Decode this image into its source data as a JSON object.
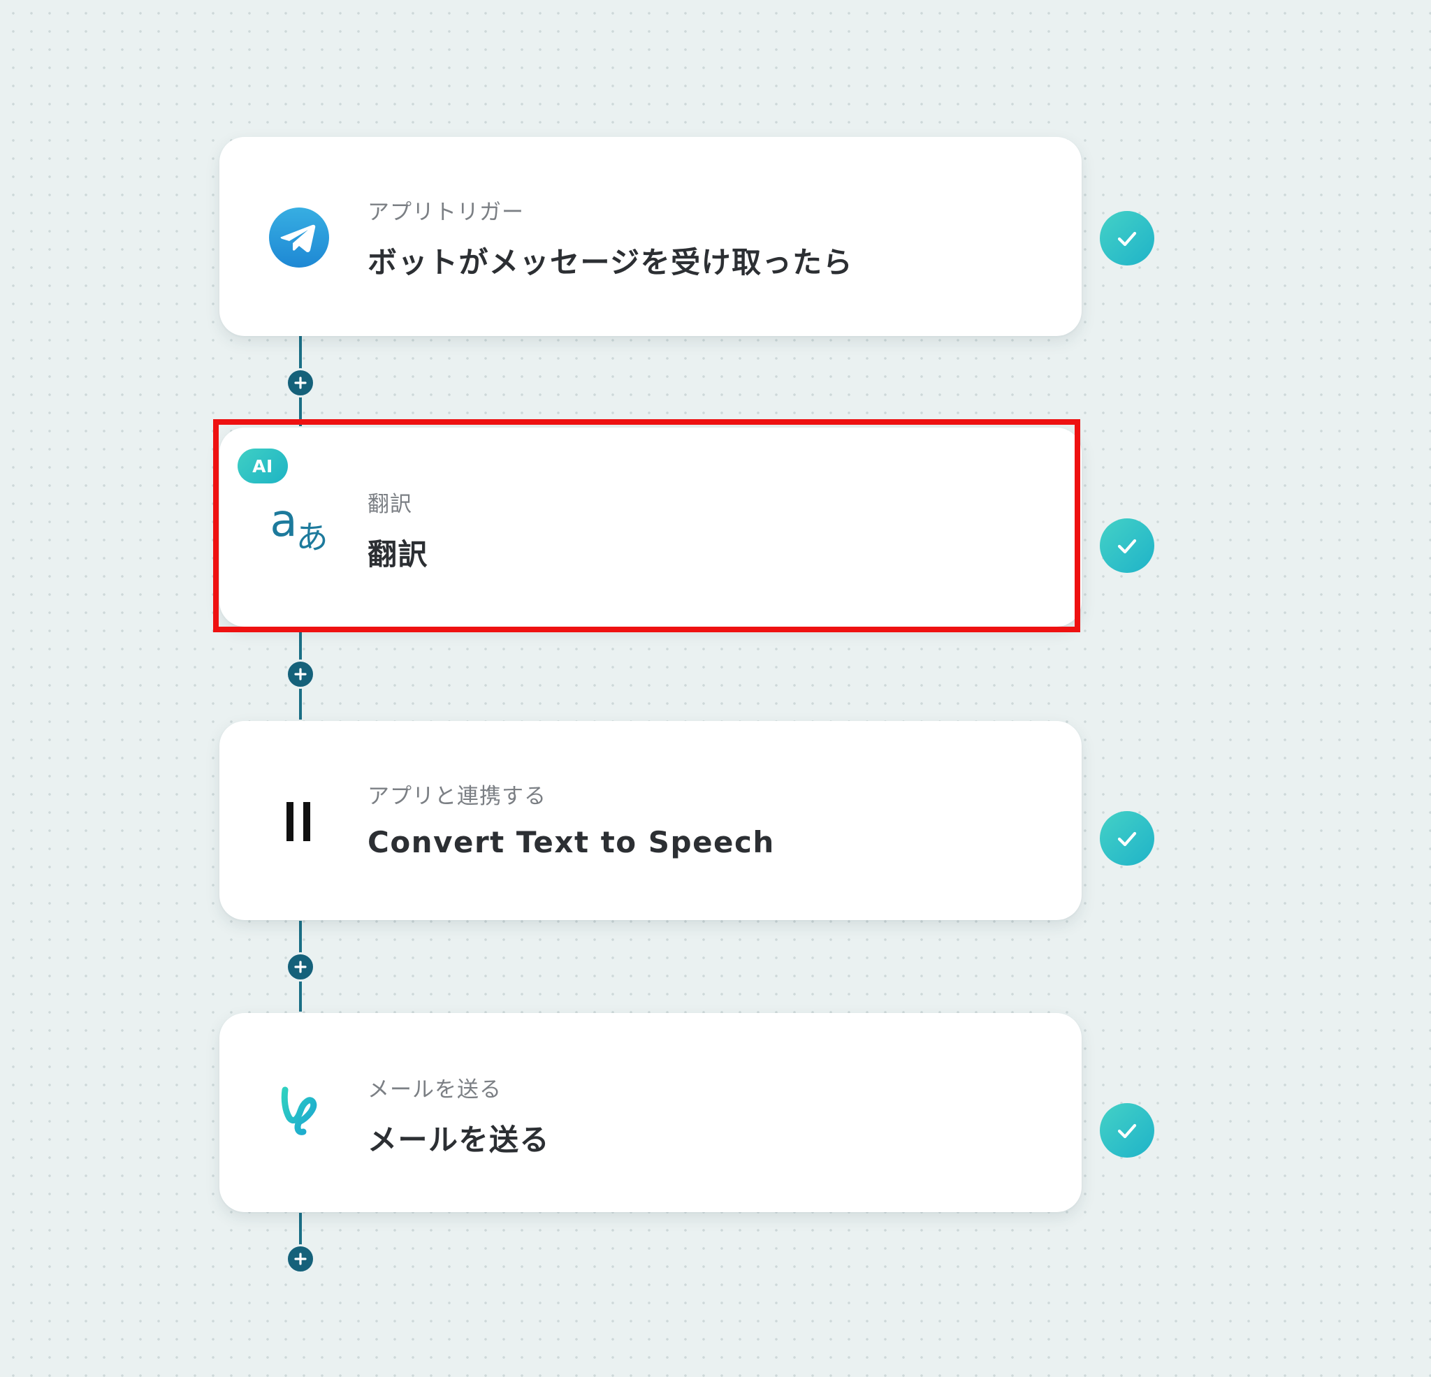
{
  "colors": {
    "background": "#eaf1f1",
    "connector": "#15617a",
    "check": "#1fb3c9",
    "selection": "#ee1111",
    "telegram": "#2b9fdc"
  },
  "steps": [
    {
      "icon": "telegram-icon",
      "kicker": "アプリトリガー",
      "title": "ボットがメッセージを受け取ったら",
      "status": "completed"
    },
    {
      "icon": "translate-icon",
      "badge": "AI",
      "glyph_latin": "a",
      "glyph_japanese": "あ",
      "kicker": "翻訳",
      "title": "翻訳",
      "status": "completed",
      "selected": true
    },
    {
      "icon": "elevenlabs-icon",
      "kicker": "アプリと連携する",
      "title": "Convert Text to Speech",
      "status": "completed"
    },
    {
      "icon": "yoom-mail-icon",
      "kicker": "メールを送る",
      "title": "メールを送る",
      "status": "completed"
    }
  ]
}
